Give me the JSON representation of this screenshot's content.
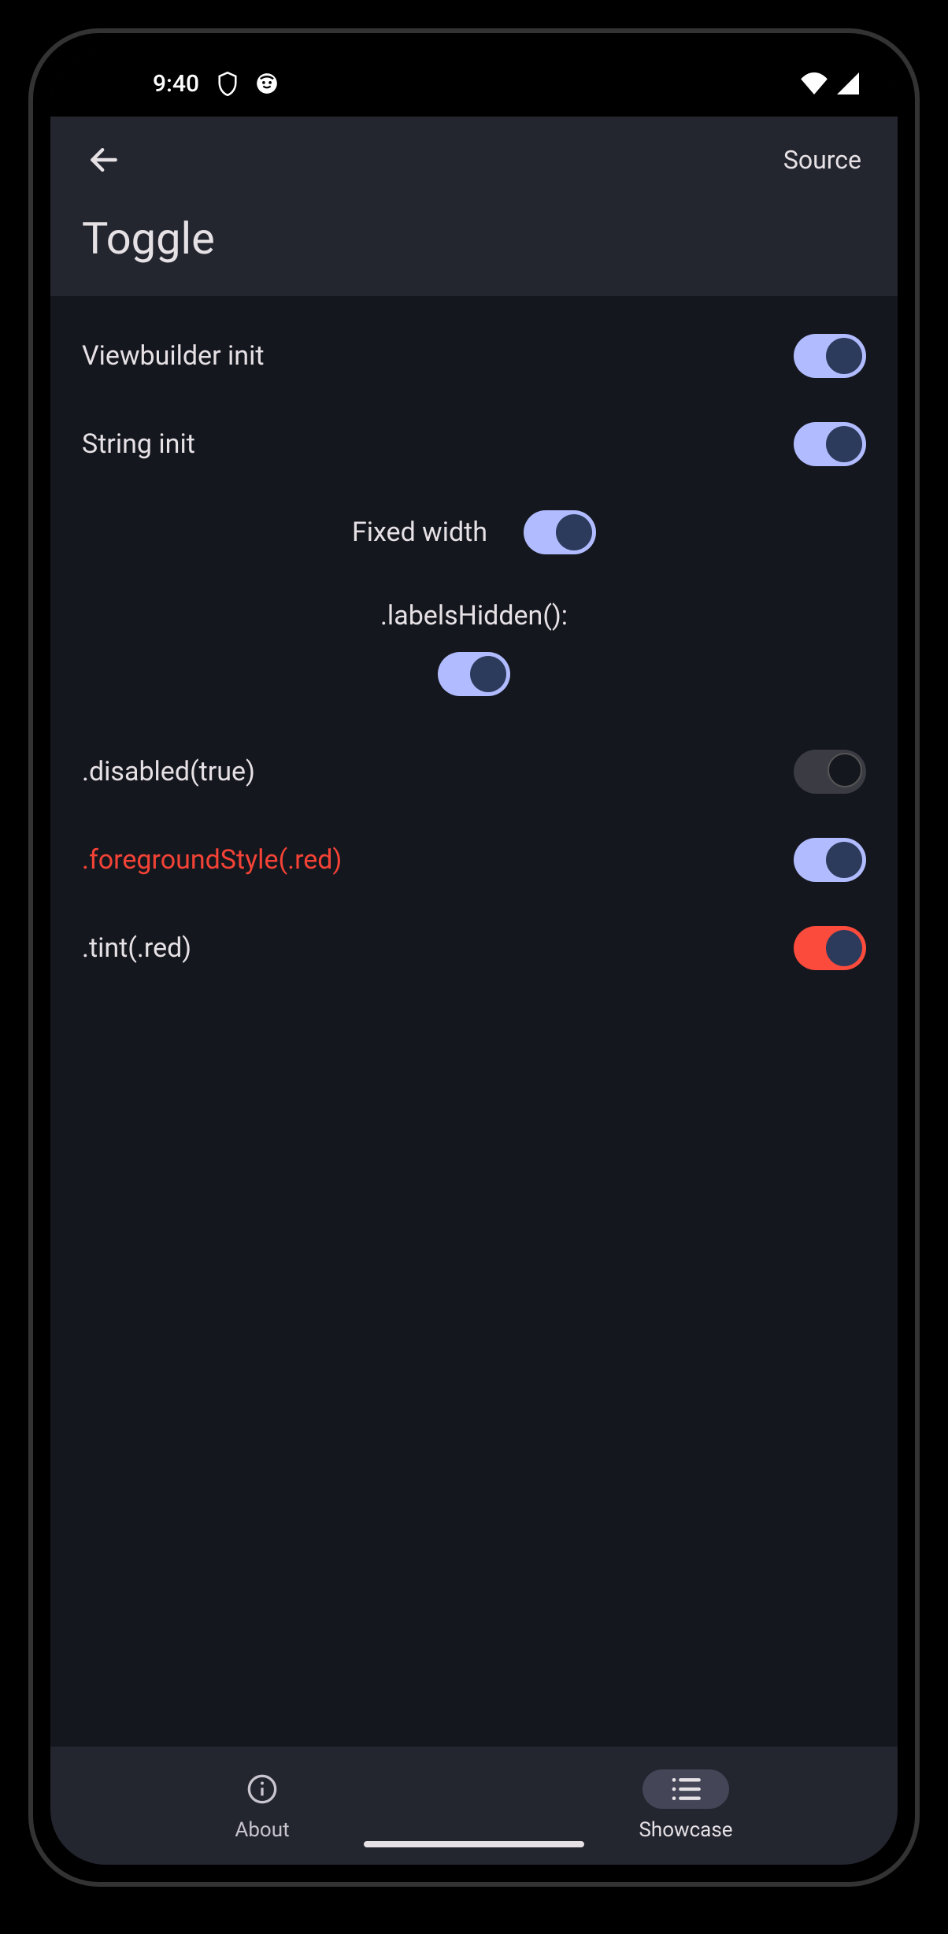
{
  "status": {
    "time": "9:40"
  },
  "header": {
    "title": "Toggle",
    "source": "Source"
  },
  "items": {
    "viewbuilder": {
      "label": "Viewbuilder init",
      "on": true
    },
    "string": {
      "label": "String init",
      "on": true
    },
    "fixed": {
      "label": "Fixed width",
      "on": true
    },
    "hidden_caption": ".labelsHidden():",
    "hidden": {
      "on": true
    },
    "disabled": {
      "label": ".disabled(true)",
      "on": false
    },
    "fgred": {
      "label": ".foregroundStyle(.red)",
      "on": true
    },
    "tint": {
      "label": ".tint(.red)",
      "on": true
    }
  },
  "nav": {
    "about": "About",
    "showcase": "Showcase"
  }
}
